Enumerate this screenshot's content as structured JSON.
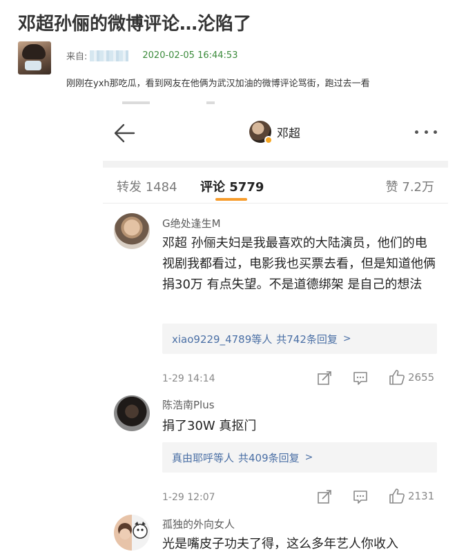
{
  "post": {
    "title": "邓超孙俪的微博评论…沦陷了",
    "source_label": "来自:",
    "time": "2020-02-05 16:44:53",
    "text": "刚刚在yxh那吃瓜，看到网友在他俩为武汉加油的微博评论骂街，跑过去一看"
  },
  "screenshot": {
    "top_user": "邓超",
    "tabs": [
      {
        "label": "转发 1484"
      },
      {
        "label": "评论 5779"
      },
      {
        "label": "赞 7.2万"
      }
    ],
    "comments": [
      {
        "name": "G绝处逢生M",
        "text": "邓超 孙俪夫妇是我最喜欢的大陆演员，他们的电视剧我都看过，电影我也买票去看，但是知道他俩捐30万 有点失望。不是道德绑架 是自己的想法",
        "reply_who": "xiao9229_4789等人",
        "reply_count": "共742条回复",
        "time": "1-29 14:14",
        "likes": "2655"
      },
      {
        "name": "陈浩南Plus",
        "text": "捐了30W 真抠门",
        "reply_who": "真由耶呼等人",
        "reply_count": "共409条回复",
        "time": "1-29 12:07",
        "likes": "2131"
      },
      {
        "name": "孤独的外向女人",
        "text": "光是嘴皮子功夫了得，这么多年艺人你收入"
      }
    ],
    "icons": {
      "back": "arrow-left-icon",
      "more": "more-dots-icon",
      "share": "share-icon",
      "comment": "comment-icon",
      "like": "thumbs-up-icon"
    },
    "colors": {
      "accent": "#f79c2b",
      "link": "#4a6fa5",
      "time_green": "#3a8a3a"
    }
  }
}
